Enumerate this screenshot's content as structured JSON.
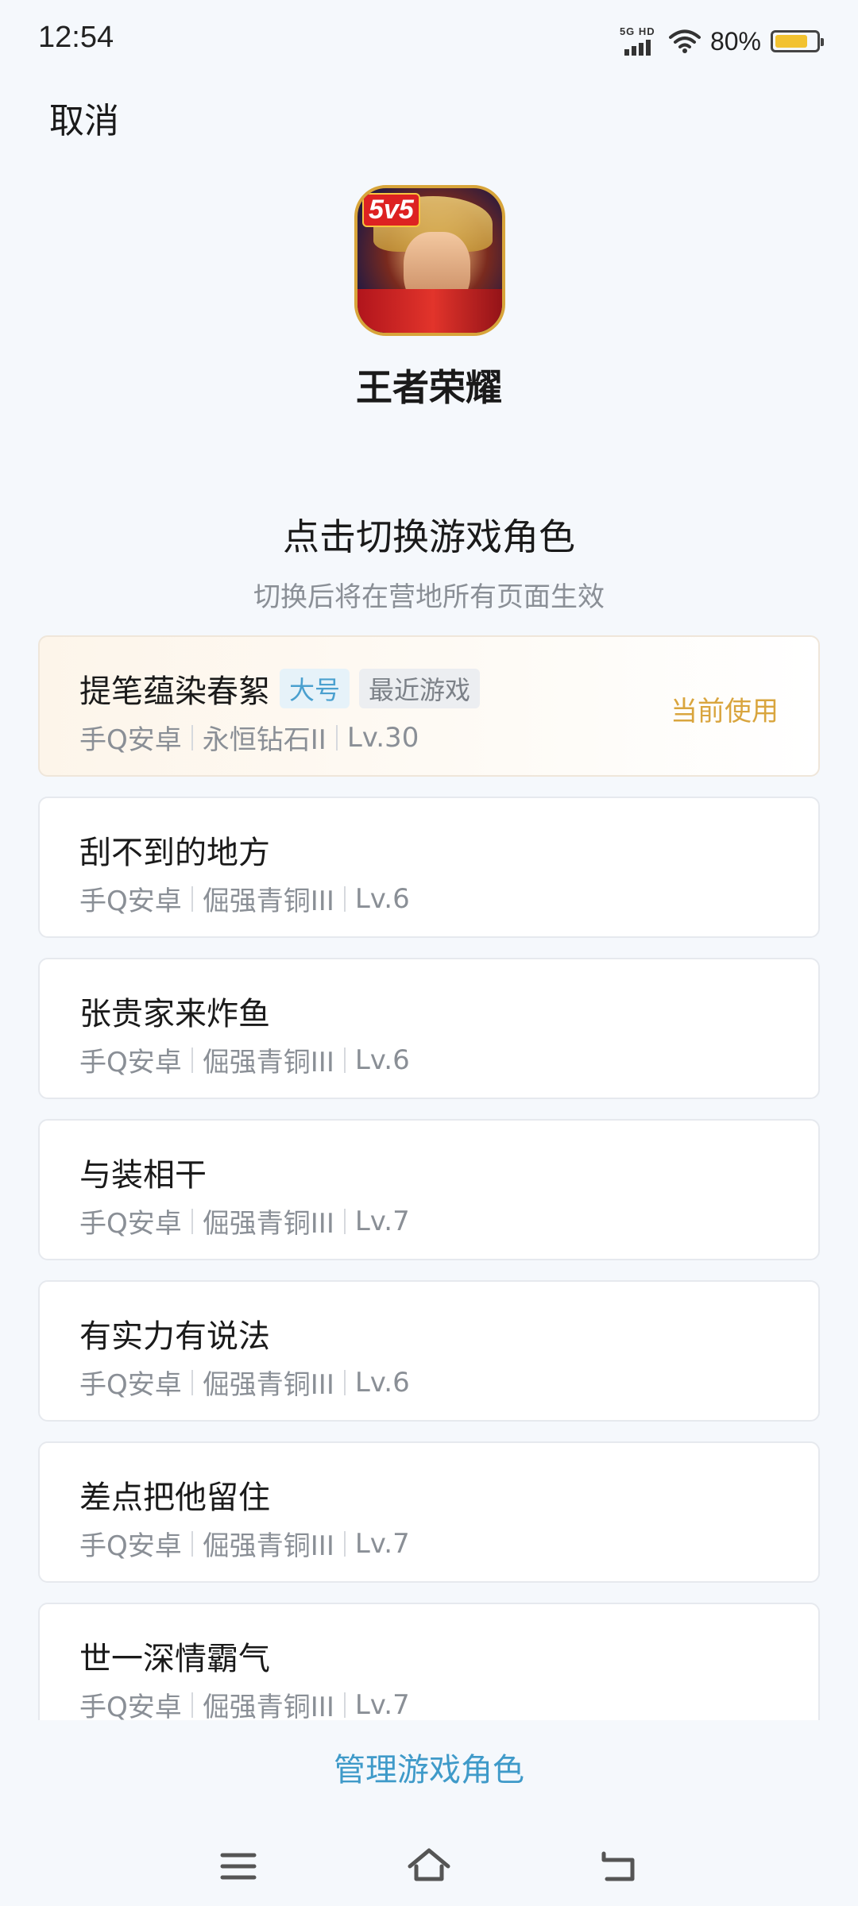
{
  "status_bar": {
    "time": "12:54",
    "network_label": "5G HD",
    "battery_text": "80%",
    "battery_level": 0.8,
    "battery_color": "#f2c230"
  },
  "header": {
    "cancel_label": "取消"
  },
  "app": {
    "name": "王者荣耀",
    "icon_badge": "5v5"
  },
  "section": {
    "title": "点击切换游戏角色",
    "subtitle": "切换后将在营地所有页面生效"
  },
  "roles": [
    {
      "name": "提笔蕴染春絮",
      "tags": [
        "大号",
        "最近游戏"
      ],
      "platform": "手Q安卓",
      "rank": "永恒钻石II",
      "level": "Lv.30",
      "status": "当前使用"
    },
    {
      "name": "刮不到的地方",
      "platform": "手Q安卓",
      "rank": "倔强青铜III",
      "level": "Lv.6"
    },
    {
      "name": "张贵家来炸鱼",
      "platform": "手Q安卓",
      "rank": "倔强青铜III",
      "level": "Lv.6"
    },
    {
      "name": "与装相干",
      "platform": "手Q安卓",
      "rank": "倔强青铜III",
      "level": "Lv.7"
    },
    {
      "name": "有实力有说法",
      "platform": "手Q安卓",
      "rank": "倔强青铜III",
      "level": "Lv.6"
    },
    {
      "name": "差点把他留住",
      "platform": "手Q安卓",
      "rank": "倔强青铜III",
      "level": "Lv.7"
    },
    {
      "name": "世一深情霸气",
      "platform": "手Q安卓",
      "rank": "倔强青铜III",
      "level": "Lv.7"
    }
  ],
  "footer": {
    "manage_label": "管理游戏角色"
  },
  "nav": {
    "icons": [
      "menu-icon",
      "home-icon",
      "back-icon"
    ]
  },
  "colors": {
    "accent_blue": "#3f9ac9",
    "current_gold": "#d9a53e",
    "background": "#f5f8fc"
  }
}
